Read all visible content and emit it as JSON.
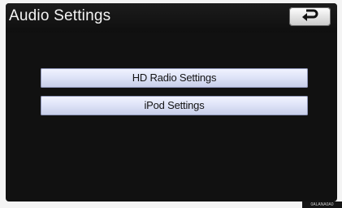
{
  "header": {
    "title": "Audio Settings",
    "back_icon": "back-arrow-icon"
  },
  "menu": {
    "items": [
      {
        "label": "HD Radio Settings"
      },
      {
        "label": "iPod Settings"
      }
    ]
  },
  "footer": {
    "code": "0ALANA0A0"
  },
  "colors": {
    "screen_background": "#111111",
    "button_face": "#dfe4f8",
    "title_text": "#f4f4f4"
  }
}
